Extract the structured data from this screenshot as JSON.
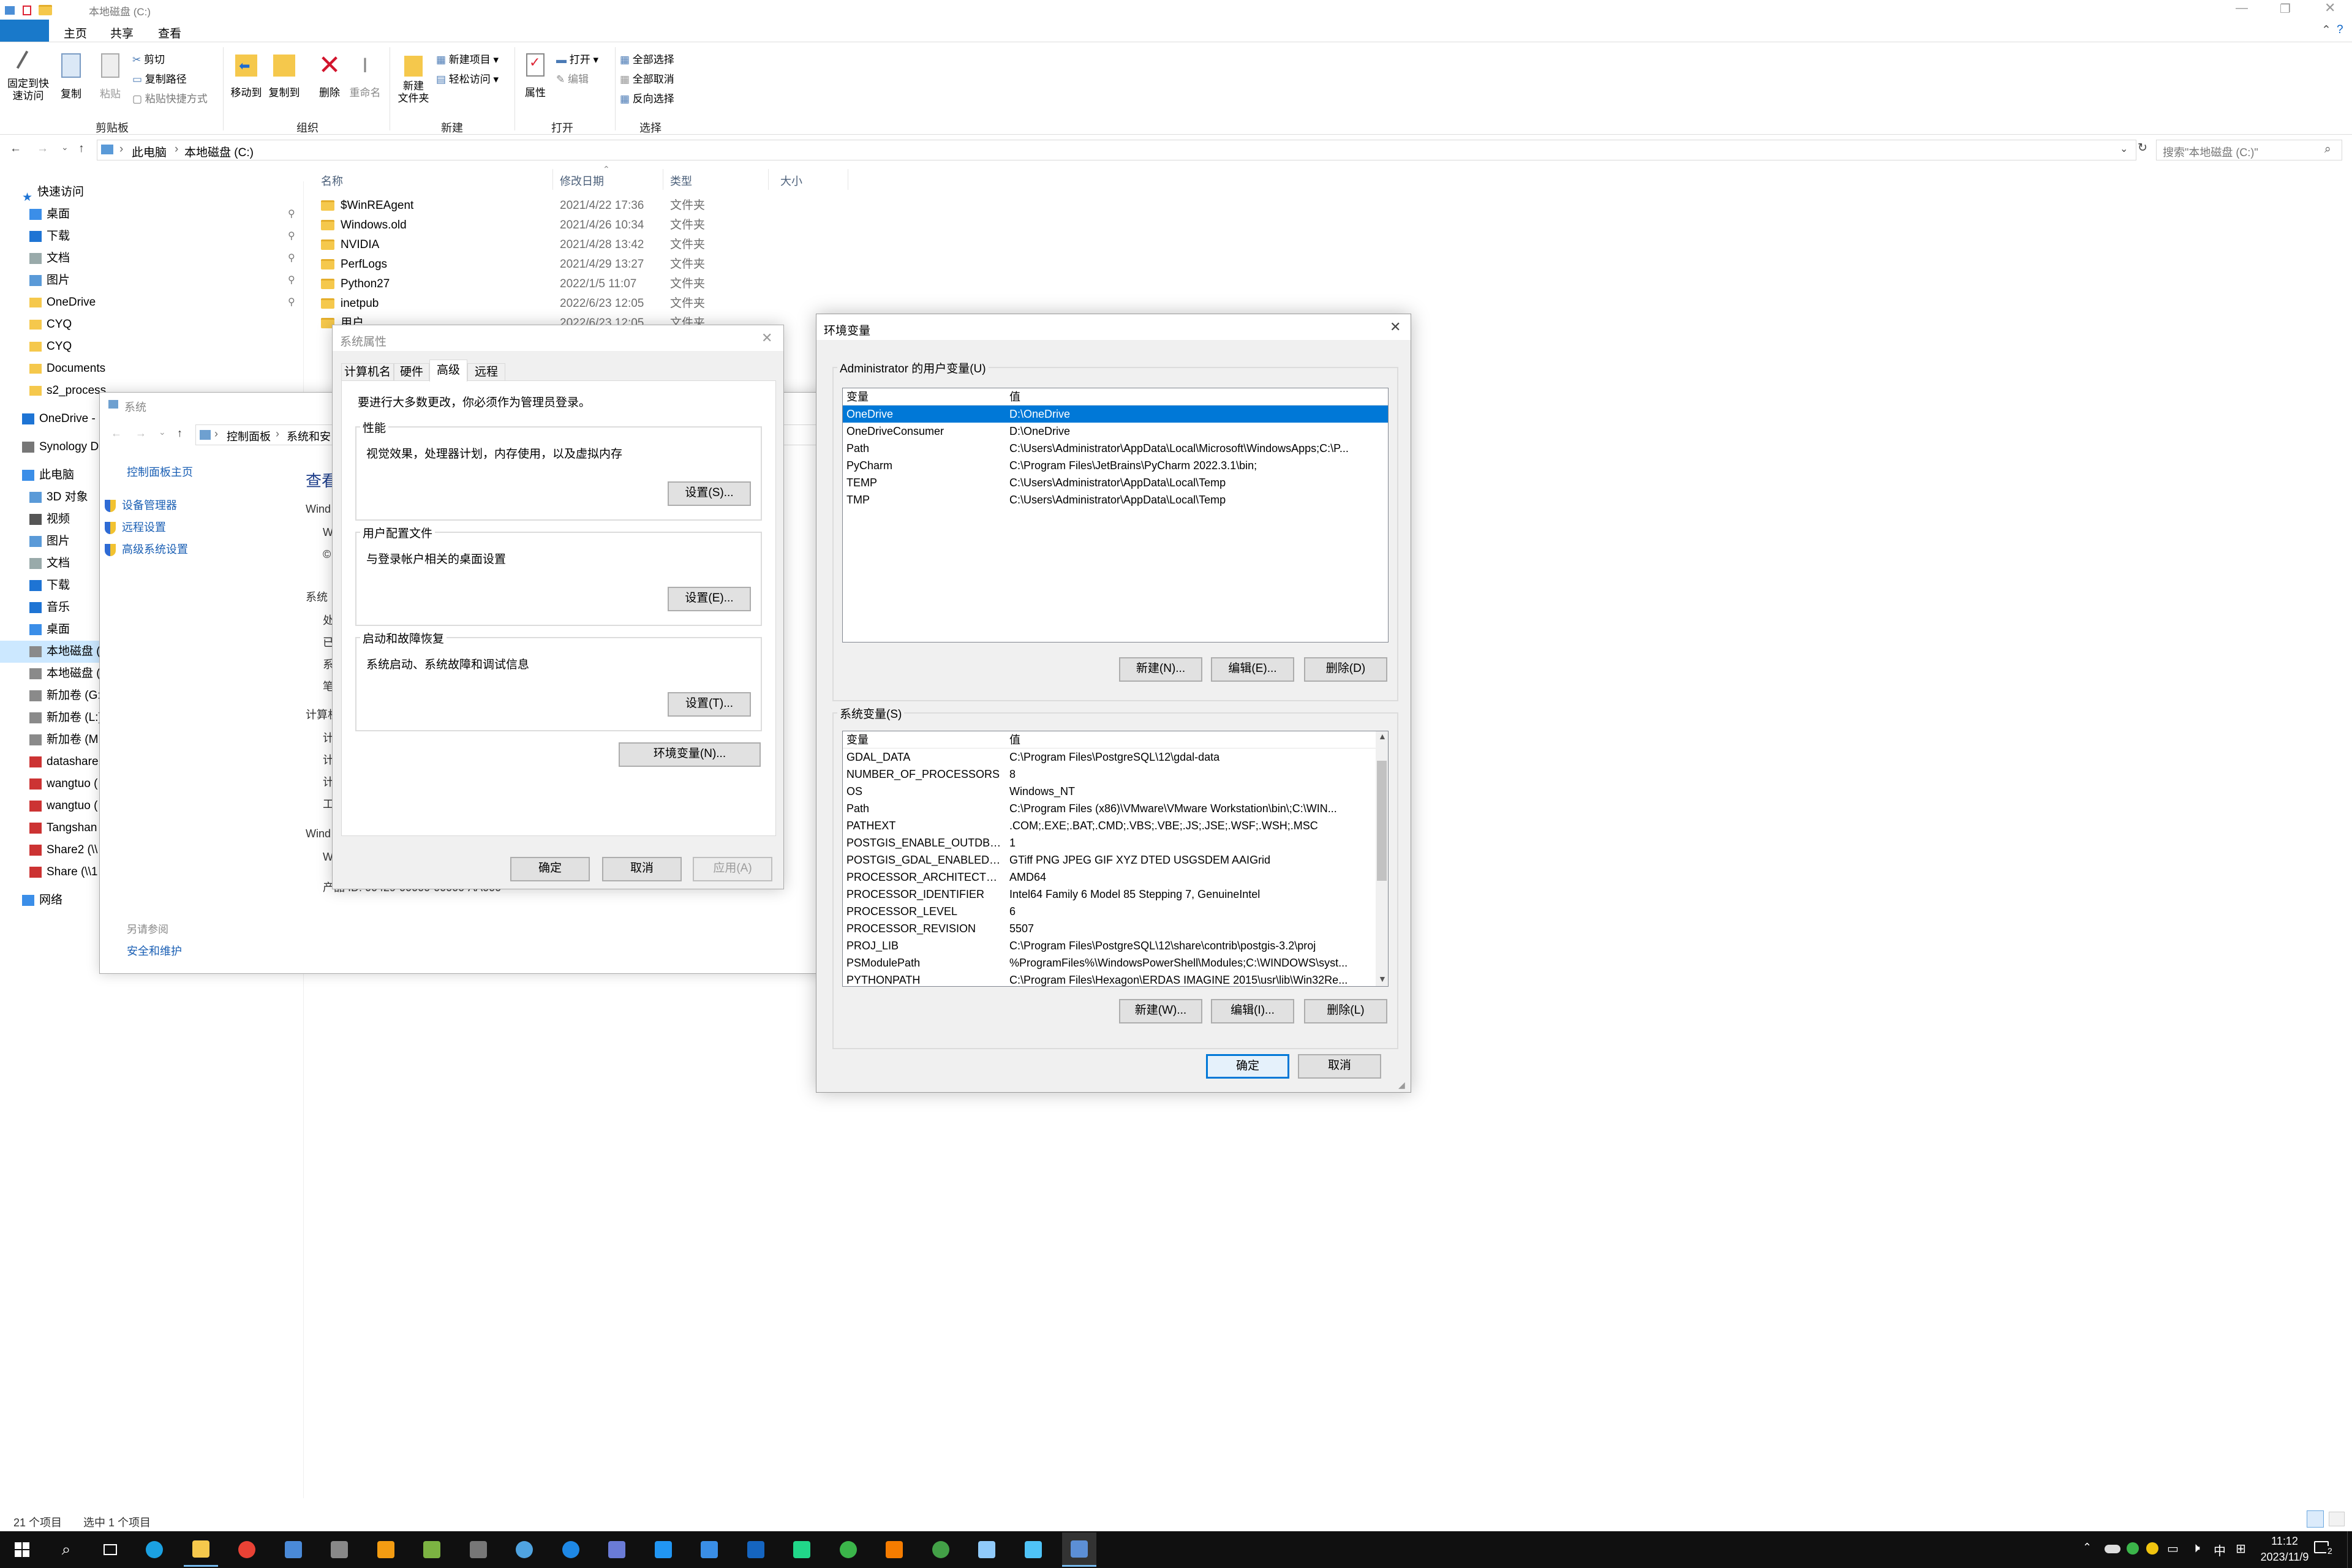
{
  "explorer": {
    "title": "本地磁盘 (C:)",
    "tabs": [
      "主页",
      "共享",
      "查看"
    ],
    "ribbon": {
      "pin_label": "固定到快\n速访问",
      "copy_label": "复制",
      "paste_label": "粘贴",
      "cut_label": "剪切",
      "copy_path_label": "复制路径",
      "paste_shortcut_label": "粘贴快捷方式",
      "move_to_label": "移动到",
      "copy_to_label": "复制到",
      "delete_label": "删除",
      "rename_label": "重命名",
      "new_folder_label": "新建\n文件夹",
      "new_item_label": "新建项目",
      "easy_access_label": "轻松访问",
      "properties_label": "属性",
      "open_label": "打开",
      "edit_label": "编辑",
      "select_all_label": "全部选择",
      "select_none_label": "全部取消",
      "invert_label": "反向选择",
      "groups": [
        "剪贴板",
        "组织",
        "新建",
        "打开",
        "选择"
      ]
    },
    "address": {
      "crumbs": [
        "此电脑",
        "本地磁盘 (C:)"
      ],
      "search_placeholder": "搜索\"本地磁盘 (C:)\""
    },
    "columns": [
      "名称",
      "修改日期",
      "类型",
      "大小"
    ],
    "files": [
      {
        "name": "$WinREAgent",
        "date": "2021/4/22 17:36",
        "type": "文件夹"
      },
      {
        "name": "Windows.old",
        "date": "2021/4/26 10:34",
        "type": "文件夹"
      },
      {
        "name": "NVIDIA",
        "date": "2021/4/28 13:42",
        "type": "文件夹"
      },
      {
        "name": "PerfLogs",
        "date": "2021/4/29 13:27",
        "type": "文件夹"
      },
      {
        "name": "Python27",
        "date": "2022/1/5 11:07",
        "type": "文件夹"
      },
      {
        "name": "inetpub",
        "date": "2022/6/23 12:05",
        "type": "文件夹"
      },
      {
        "name": "用户",
        "date": "2022/6/23 12:05",
        "type": "文件夹"
      }
    ],
    "nav": [
      {
        "label": "快速访问",
        "icon": "star-icon",
        "indent": 0,
        "pin": false
      },
      {
        "label": "桌面",
        "icon": "desktop-icon",
        "indent": 1,
        "pin": true
      },
      {
        "label": "下载",
        "icon": "download-icon",
        "indent": 1,
        "pin": true
      },
      {
        "label": "文档",
        "icon": "document-icon",
        "indent": 1,
        "pin": true
      },
      {
        "label": "图片",
        "icon": "picture-icon",
        "indent": 1,
        "pin": true
      },
      {
        "label": "OneDrive",
        "icon": "folder-icon",
        "indent": 1,
        "pin": true
      },
      {
        "label": "CYQ",
        "icon": "folder-icon",
        "indent": 1,
        "pin": false
      },
      {
        "label": "CYQ",
        "icon": "folder-icon",
        "indent": 1,
        "pin": false
      },
      {
        "label": "Documents",
        "icon": "folder-icon",
        "indent": 1,
        "pin": false
      },
      {
        "label": "s2_process",
        "icon": "folder-icon",
        "indent": 1,
        "pin": false
      },
      {
        "label": "OneDrive - ",
        "icon": "cloud-icon",
        "indent": 0,
        "pin": false
      },
      {
        "label": "Synology D",
        "icon": "nas-icon",
        "indent": 0,
        "pin": false
      },
      {
        "label": "此电脑",
        "icon": "pc-icon",
        "indent": 0,
        "pin": false
      },
      {
        "label": "3D 对象",
        "icon": "cube-icon",
        "indent": 1,
        "pin": false
      },
      {
        "label": "视频",
        "icon": "video-icon",
        "indent": 1,
        "pin": false
      },
      {
        "label": "图片",
        "icon": "picture-icon",
        "indent": 1,
        "pin": false
      },
      {
        "label": "文档",
        "icon": "document-icon",
        "indent": 1,
        "pin": false
      },
      {
        "label": "下载",
        "icon": "download-icon",
        "indent": 1,
        "pin": false
      },
      {
        "label": "音乐",
        "icon": "music-icon",
        "indent": 1,
        "pin": false
      },
      {
        "label": "桌面",
        "icon": "desktop-icon",
        "indent": 1,
        "pin": false
      },
      {
        "label": "本地磁盘 (",
        "icon": "drive-icon",
        "indent": 1,
        "pin": false,
        "selected": true
      },
      {
        "label": "本地磁盘 (",
        "icon": "drive-icon",
        "indent": 1,
        "pin": false
      },
      {
        "label": "新加卷 (G:)",
        "icon": "drive-icon",
        "indent": 1,
        "pin": false
      },
      {
        "label": "新加卷 (L:)",
        "icon": "drive-icon",
        "indent": 1,
        "pin": false
      },
      {
        "label": "新加卷 (M",
        "icon": "drive-icon",
        "indent": 1,
        "pin": false
      },
      {
        "label": "datashare",
        "icon": "network-drive-icon",
        "indent": 1,
        "pin": false
      },
      {
        "label": "wangtuo (",
        "icon": "network-drive-icon",
        "indent": 1,
        "pin": false
      },
      {
        "label": "wangtuo (",
        "icon": "network-drive-icon",
        "indent": 1,
        "pin": false
      },
      {
        "label": "Tangshan",
        "icon": "network-drive-icon",
        "indent": 1,
        "pin": false
      },
      {
        "label": "Share2 (\\\\",
        "icon": "network-drive-icon",
        "indent": 1,
        "pin": false
      },
      {
        "label": "Share (\\\\1",
        "icon": "network-drive-icon",
        "indent": 1,
        "pin": false
      },
      {
        "label": "网络",
        "icon": "network-icon",
        "indent": 0,
        "pin": false
      }
    ],
    "status": {
      "count": "21 个项目",
      "selected": "选中 1 个项目"
    }
  },
  "system": {
    "title": "系统",
    "crumbs": [
      "控制面板",
      "系统和安"
    ],
    "home_link": "控制面板主页",
    "links": [
      "设备管理器",
      "远程设置",
      "高级系统设置"
    ],
    "see_also": "另请参阅",
    "security_link": "安全和维护",
    "heading": "查看",
    "labels": [
      "Wind",
      "W",
      "©",
      "系统",
      "处",
      "已",
      "系",
      "笔",
      "计算机",
      "计",
      "计",
      "计",
      "工",
      "Wind",
      "W"
    ],
    "product_id": "产品 ID: 00429-00000-00000-AA000"
  },
  "sysprops": {
    "title": "系统属性",
    "tabs": [
      "计算机名",
      "硬件",
      "高级",
      "远程"
    ],
    "active_tab": "高级",
    "admin_note": "要进行大多数更改，你必须作为管理员登录。",
    "perf_title": "性能",
    "perf_desc": "视觉效果，处理器计划，内存使用，以及虚拟内存",
    "perf_btn": "设置(S)...",
    "profile_title": "用户配置文件",
    "profile_desc": "与登录帐户相关的桌面设置",
    "profile_btn": "设置(E)...",
    "startup_title": "启动和故障恢复",
    "startup_desc": "系统启动、系统故障和调试信息",
    "startup_btn": "设置(T)...",
    "env_btn": "环境变量(N)...",
    "ok": "确定",
    "cancel": "取消",
    "apply": "应用(A)"
  },
  "envvars": {
    "title": "环境变量",
    "user_group": "Administrator 的用户变量(U)",
    "col_var": "变量",
    "col_val": "值",
    "user_vars": [
      {
        "name": "OneDrive",
        "value": "D:\\OneDrive"
      },
      {
        "name": "OneDriveConsumer",
        "value": "D:\\OneDrive"
      },
      {
        "name": "Path",
        "value": "C:\\Users\\Administrator\\AppData\\Local\\Microsoft\\WindowsApps;C:\\P..."
      },
      {
        "name": "PyCharm",
        "value": "C:\\Program Files\\JetBrains\\PyCharm 2022.3.1\\bin;"
      },
      {
        "name": "TEMP",
        "value": "C:\\Users\\Administrator\\AppData\\Local\\Temp"
      },
      {
        "name": "TMP",
        "value": "C:\\Users\\Administrator\\AppData\\Local\\Temp"
      }
    ],
    "user_new": "新建(N)...",
    "user_edit": "编辑(E)...",
    "user_delete": "删除(D)",
    "sys_group": "系统变量(S)",
    "sys_vars": [
      {
        "name": "GDAL_DATA",
        "value": "C:\\Program Files\\PostgreSQL\\12\\gdal-data"
      },
      {
        "name": "NUMBER_OF_PROCESSORS",
        "value": "8"
      },
      {
        "name": "OS",
        "value": "Windows_NT"
      },
      {
        "name": "Path",
        "value": "C:\\Program Files (x86)\\VMware\\VMware Workstation\\bin\\;C:\\WIN..."
      },
      {
        "name": "PATHEXT",
        "value": ".COM;.EXE;.BAT;.CMD;.VBS;.VBE;.JS;.JSE;.WSF;.WSH;.MSC"
      },
      {
        "name": "POSTGIS_ENABLE_OUTDB_R...",
        "value": "1"
      },
      {
        "name": "POSTGIS_GDAL_ENABLED_D...",
        "value": "GTiff PNG JPEG GIF XYZ DTED USGSDEM AAIGrid"
      },
      {
        "name": "PROCESSOR_ARCHITECTURE",
        "value": "AMD64"
      },
      {
        "name": "PROCESSOR_IDENTIFIER",
        "value": "Intel64 Family 6 Model 85 Stepping 7, GenuineIntel"
      },
      {
        "name": "PROCESSOR_LEVEL",
        "value": "6"
      },
      {
        "name": "PROCESSOR_REVISION",
        "value": "5507"
      },
      {
        "name": "PROJ_LIB",
        "value": "C:\\Program Files\\PostgreSQL\\12\\share\\contrib\\postgis-3.2\\proj"
      },
      {
        "name": "PSModulePath",
        "value": "%ProgramFiles%\\WindowsPowerShell\\Modules;C:\\WINDOWS\\syst..."
      },
      {
        "name": "PYTHONPATH",
        "value": "C:\\Program Files\\Hexagon\\ERDAS IMAGINE 2015\\usr\\lib\\Win32Re..."
      }
    ],
    "sys_new": "新建(W)...",
    "sys_edit": "编辑(I)...",
    "sys_delete": "删除(L)",
    "ok": "确定",
    "cancel": "取消"
  },
  "taskbar": {
    "apps": [
      "edge-icon",
      "file-explorer-icon",
      "chrome-icon",
      "search-tool-icon",
      "vm-icon",
      "app-lm-icon",
      "qgis-icon",
      "app-icon",
      "droplet-icon",
      "app-blue-icon",
      "onedrive-link-icon",
      "vscode-icon",
      "app-plane-icon",
      "app-arp-icon",
      "pycharm-icon",
      "wechat-icon",
      "search-orange-icon",
      "app-circle-icon",
      "notepad-icon",
      "app-window-icon",
      "system-control-icon"
    ],
    "ime": "中",
    "time": "11:12",
    "date": "2023/11/9",
    "notif_count": "2"
  }
}
